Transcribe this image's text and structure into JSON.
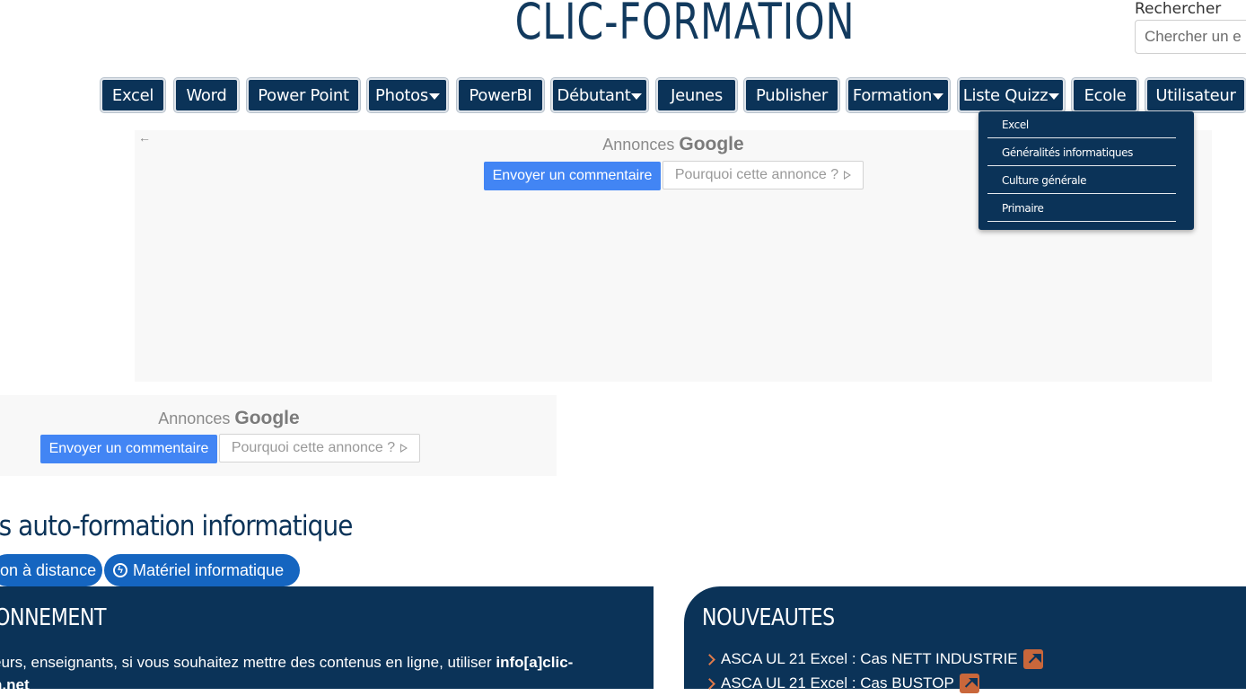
{
  "site": {
    "title": "CLIC-FORMATION"
  },
  "search": {
    "label": "Rechercher",
    "placeholder": "Chercher un e"
  },
  "nav": {
    "items": [
      {
        "label": "Excel",
        "dropdown": false
      },
      {
        "label": "Word",
        "dropdown": false
      },
      {
        "label": "Power Point",
        "dropdown": false
      },
      {
        "label": "Photos",
        "dropdown": true
      },
      {
        "label": "PowerBI",
        "dropdown": false
      },
      {
        "label": "Débutant",
        "dropdown": true
      },
      {
        "label": "Jeunes",
        "dropdown": false
      },
      {
        "label": "Publisher",
        "dropdown": false
      },
      {
        "label": "Formation",
        "dropdown": true
      },
      {
        "label": "Liste Quizz",
        "dropdown": true
      },
      {
        "label": "Ecole",
        "dropdown": false
      },
      {
        "label": "Utilisateur",
        "dropdown": false
      }
    ]
  },
  "quiz_dropdown": {
    "items": [
      "Excel",
      "Généralités informatiques",
      "Culture générale",
      "Primaire"
    ]
  },
  "ads": {
    "back_arrow": "←",
    "label_prefix": "Annonces",
    "label_brand": "Google",
    "send_label": "Envoyer un commentaire",
    "why_label": "Pourquoi cette annonce ?"
  },
  "main": {
    "heading": "rs auto-formation informatique",
    "pills": [
      {
        "label": "on à distance"
      },
      {
        "label": "Matériel informatique",
        "icon": "bolt-icon"
      }
    ]
  },
  "panels": {
    "left": {
      "title": "ONNEMENT",
      "text_line1_prefix": "eurs, enseignants, si vous souhaitez mettre des contenus en ligne, utiliser ",
      "text_line1_bold": "info[a]clic-",
      "text_line2_bold": "n.net"
    },
    "right": {
      "title": "NOUVEAUTES",
      "items": [
        {
          "label": "ASCA UL 21 Excel : Cas NETT INDUSTRIE"
        },
        {
          "label": "ASCA UL 21 Excel : Cas BUSTOP"
        }
      ]
    }
  },
  "colors": {
    "navy": "#0b3358",
    "title_blue": "#123a5e",
    "google_blue": "#4285f4",
    "pill_blue": "#1565c0",
    "accent_orange": "#c9673b"
  }
}
